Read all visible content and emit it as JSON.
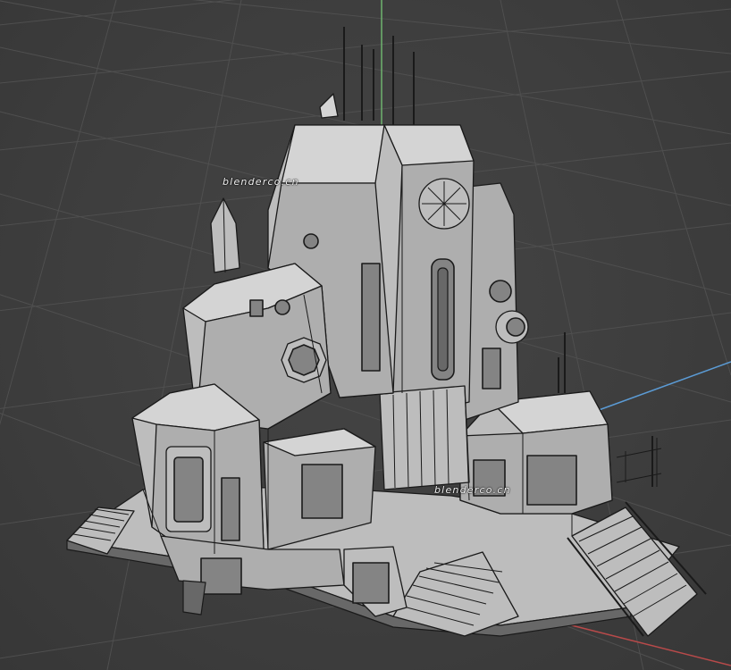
{
  "viewport": {
    "watermarks": [
      "blenderco.cn",
      "blenderco.cn"
    ],
    "axis_colors": {
      "x": "#b84a4a",
      "y": "#5b9bd5",
      "z": "#6fb36f"
    },
    "background_color": "#3d3d3d",
    "grid_color": "#4f4f4f",
    "model": {
      "shading": "solid-with-wireframe",
      "surface_color": "#bdbdbd",
      "edge_color": "#1a1a1a"
    }
  }
}
